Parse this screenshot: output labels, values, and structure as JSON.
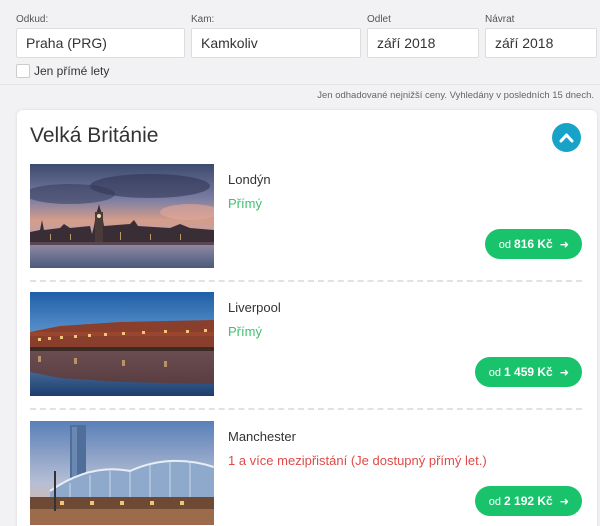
{
  "search": {
    "from_label": "Odkud:",
    "from_value": "Praha (PRG)",
    "to_label": "Kam:",
    "to_value": "Kamkoliv",
    "depart_label": "Odlet",
    "depart_value": "září 2018",
    "return_label": "Návrat",
    "return_value": "září 2018",
    "direct_only_label": "Jen přímé lety",
    "direct_only_checked": false
  },
  "note": "Jen odhadované nejnižší ceny. Vyhledány v posledních 15 dnech.",
  "country": {
    "title": "Velká Británie",
    "collapse_icon": "chevron-up-icon",
    "destinations": [
      {
        "city": "Londýn",
        "stops": "Přímý",
        "price_prefix": "od",
        "price": "816 Kč"
      },
      {
        "city": "Liverpool",
        "stops": "Přímý",
        "price_prefix": "od",
        "price": "1 459 Kč"
      },
      {
        "city": "Manchester",
        "stops": "1 a více mezipřistání (Je dostupný přímý let.)",
        "price_prefix": "od",
        "price": "2 192 Kč"
      }
    ]
  },
  "colors": {
    "accent": "#17a2c8",
    "price_button": "#19c36b",
    "direct": "#3fbf6d",
    "indirect": "#e04a48"
  }
}
